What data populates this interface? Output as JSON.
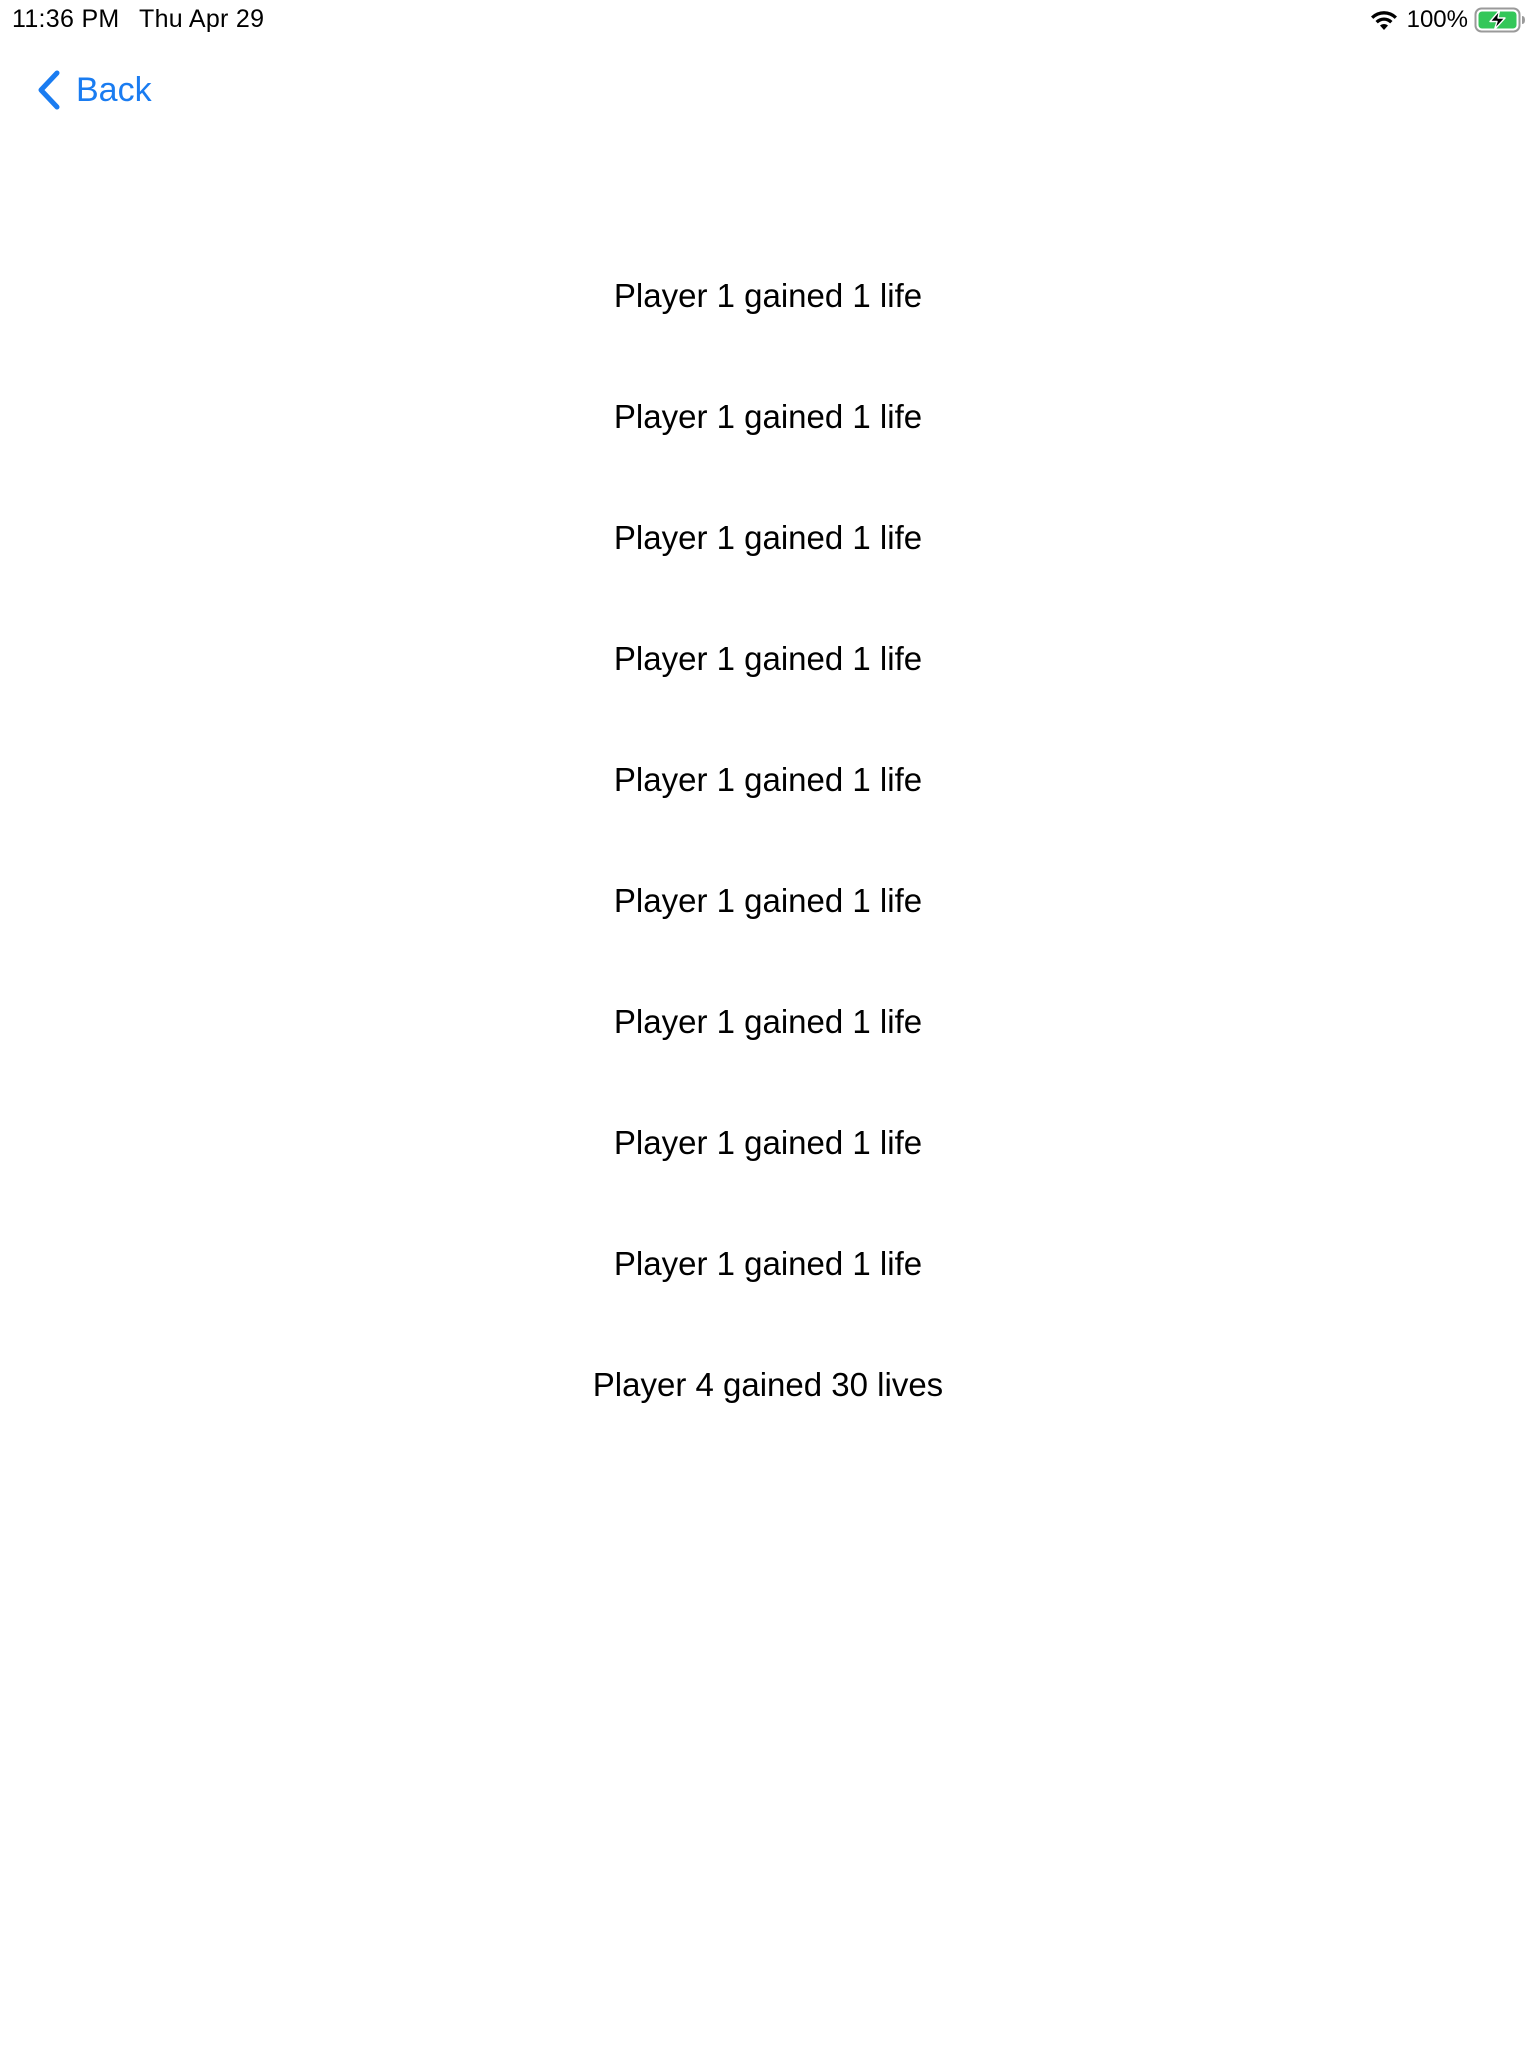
{
  "status_bar": {
    "time": "11:36 PM",
    "date": "Thu Apr 29",
    "battery_percent": "100%",
    "battery_charging": true,
    "icons": [
      "wifi-icon",
      "battery-charging-icon"
    ]
  },
  "nav": {
    "back_label": "Back",
    "accent_color": "#1a7cf1",
    "icon": "chevron-left-icon"
  },
  "log": {
    "entries": [
      "Player 1 gained 1 life",
      "Player 1 gained 1 life",
      "Player 1 gained 1 life",
      "Player 1 gained 1 life",
      "Player 1 gained 1 life",
      "Player 1 gained 1 life",
      "Player 1 gained 1 life",
      "Player 1 gained 1 life",
      "Player 1 gained 1 life",
      "Player 4 gained 30 lives"
    ]
  }
}
